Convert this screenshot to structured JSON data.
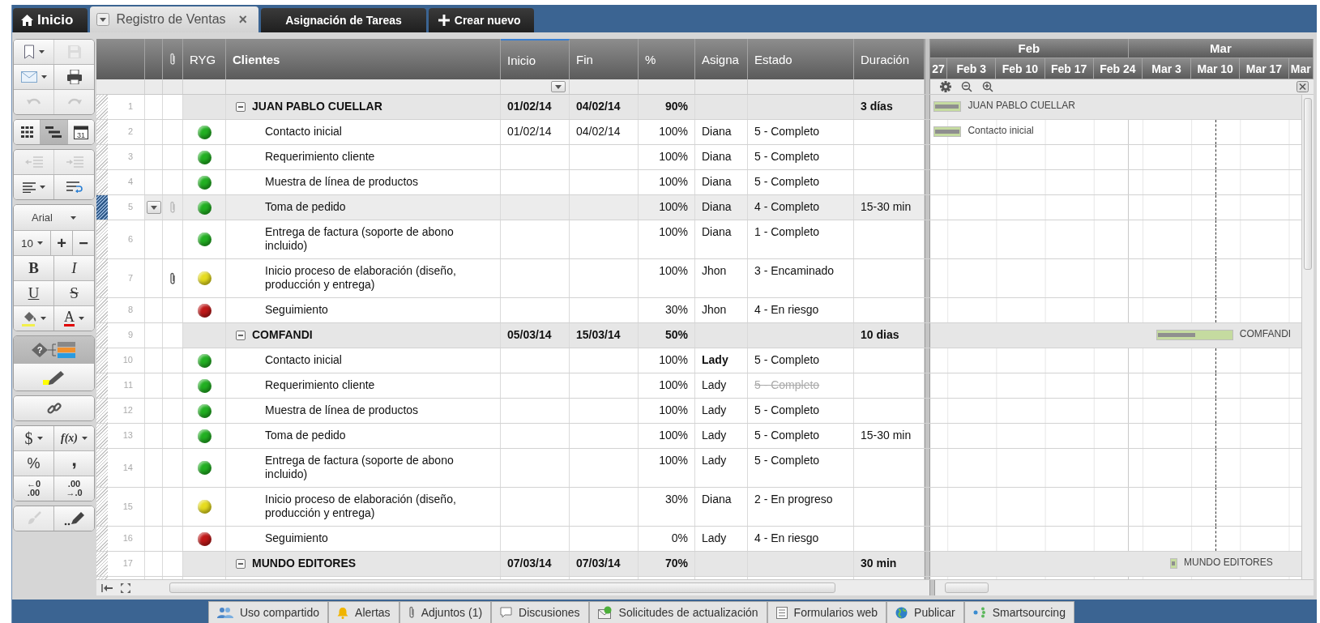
{
  "tabs": [
    {
      "label": "Inicio",
      "kind": "home",
      "selected": false
    },
    {
      "label": "Registro de Ventas",
      "kind": "sheet",
      "selected": true,
      "close": "×"
    },
    {
      "label": "Asignación de Tareas",
      "kind": "sheet",
      "selected": false
    },
    {
      "label": "Crear nuevo",
      "kind": "create",
      "selected": false
    }
  ],
  "toolbar": [
    [
      [
        {
          "kind": "bookmark",
          "dropdown": true,
          "disabled": false
        },
        {
          "kind": "save",
          "disabled": true
        }
      ],
      [
        {
          "kind": "email",
          "dropdown": true,
          "disabled": false
        },
        {
          "kind": "print",
          "disabled": false
        }
      ],
      [
        {
          "kind": "undo",
          "disabled": true
        },
        {
          "kind": "redo",
          "disabled": true
        }
      ]
    ],
    [
      [
        {
          "kind": "grid-view",
          "selected": false,
          "disabled": false
        },
        {
          "kind": "gantt-view",
          "selected": true,
          "disabled": false
        },
        {
          "kind": "calendar-view",
          "selected": false,
          "disabled": false,
          "text": "31"
        }
      ]
    ],
    [
      [
        {
          "kind": "outdent",
          "disabled": true
        },
        {
          "kind": "indent",
          "disabled": true
        }
      ],
      [
        {
          "kind": "align",
          "dropdown": true,
          "disabled": false
        },
        {
          "kind": "wrap-text",
          "disabled": false
        }
      ]
    ],
    [
      [
        {
          "kind": "font-family",
          "text": "Arial",
          "dropdown": true,
          "disabled": false
        }
      ],
      [
        {
          "kind": "font-size",
          "text": "10",
          "dropdown": true,
          "disabled": false
        },
        {
          "kind": "increase-size",
          "text": "+",
          "disabled": false
        },
        {
          "kind": "decrease-size",
          "text": "−",
          "disabled": false
        }
      ],
      [
        {
          "kind": "bold",
          "text": "B",
          "disabled": false
        },
        {
          "kind": "italic",
          "text": "I",
          "disabled": false
        }
      ],
      [
        {
          "kind": "underline",
          "text": "U",
          "disabled": false
        },
        {
          "kind": "strikethrough",
          "text": "S",
          "disabled": false
        }
      ],
      [
        {
          "kind": "fill-color",
          "dropdown": true,
          "disabled": false
        },
        {
          "kind": "text-color",
          "text": "A",
          "dropdown": true,
          "disabled": false
        }
      ]
    ],
    [
      [
        {
          "kind": "conditional-format",
          "text": "?",
          "on": true,
          "disabled": false
        }
      ],
      [
        {
          "kind": "highlight",
          "on": false,
          "disabled": false
        }
      ]
    ],
    [
      [
        {
          "kind": "link",
          "disabled": false
        }
      ]
    ],
    [
      [
        {
          "kind": "currency",
          "text": "$",
          "dropdown": true,
          "disabled": false
        },
        {
          "kind": "formula",
          "text": "f(x)",
          "dropdown": true,
          "disabled": false
        }
      ],
      [
        {
          "kind": "percent",
          "text": "%",
          "disabled": false
        },
        {
          "kind": "comma-style",
          "text": ",",
          "disabled": false
        }
      ],
      [
        {
          "kind": "decrease-decimals",
          "text": "←0",
          "text2": ".00",
          "disabled": false
        },
        {
          "kind": "increase-decimals",
          "text": ".00",
          "text2": "→.0",
          "disabled": false
        }
      ]
    ],
    [
      [
        {
          "kind": "clear-format",
          "disabled": true
        },
        {
          "kind": "format-painter",
          "disabled": false
        }
      ]
    ]
  ],
  "columns": [
    {
      "label": "RYG",
      "kind": "field",
      "sorted": false
    },
    {
      "label": "Clientes",
      "kind": "primary",
      "sorted": false
    },
    {
      "label": "Inicio",
      "kind": "field",
      "sorted": true
    },
    {
      "label": "Fin",
      "kind": "field",
      "sorted": false
    },
    {
      "label": "%",
      "kind": "field",
      "sorted": false
    },
    {
      "label": "Asigna",
      "kind": "field",
      "sorted": false
    },
    {
      "label": "Estado",
      "kind": "field",
      "sorted": false
    },
    {
      "label": "Duración",
      "kind": "field",
      "sorted": false
    }
  ],
  "gantt": {
    "months": [
      "Feb",
      "Mar"
    ],
    "weeks": [
      "27",
      "Feb 3",
      "Feb 10",
      "Feb 17",
      "Feb 24",
      "Mar 3",
      "Mar 10",
      "Mar 17",
      "Mar"
    ]
  },
  "rows": [
    {
      "num": "1",
      "kind": "group",
      "expanded": true,
      "selected": false,
      "attachment": false,
      "name": "JUAN PABLO CUELLAR",
      "inicio": "01/02/14",
      "fin": "04/02/14",
      "pct": "90%",
      "duracion": "3 días",
      "gantt": {
        "label": "JUAN PABLO CUELLAR",
        "level": 0.9
      }
    },
    {
      "num": "2",
      "kind": "task",
      "selected": false,
      "attachment": false,
      "color": "#22b022",
      "name": "Contacto inicial",
      "inicio": "01/02/14",
      "fin": "04/02/14",
      "pct": "100%",
      "asigna": "Diana",
      "asigna_bold": false,
      "estado": "5 - Completo",
      "estado_strike": false,
      "gantt": {
        "label": "Contacto inicial",
        "level": 1
      }
    },
    {
      "num": "3",
      "kind": "task",
      "selected": false,
      "attachment": false,
      "color": "#22b022",
      "name": "Requerimiento cliente",
      "pct": "100%",
      "asigna": "Diana",
      "asigna_bold": false,
      "estado": "5 - Completo",
      "estado_strike": false
    },
    {
      "num": "4",
      "kind": "task",
      "selected": false,
      "attachment": false,
      "color": "#22b022",
      "name": "Muestra de línea de productos",
      "pct": "100%",
      "asigna": "Diana",
      "asigna_bold": false,
      "estado": "5 - Completo",
      "estado_strike": false
    },
    {
      "num": "5",
      "kind": "task",
      "selected": true,
      "attachment": false,
      "color": "#22b022",
      "name": "Toma de pedido",
      "pct": "100%",
      "asigna": "Diana",
      "asigna_bold": false,
      "estado": "4 - Completo",
      "estado_strike": false,
      "duracion": "15-30 min"
    },
    {
      "num": "6",
      "kind": "task",
      "selected": false,
      "attachment": false,
      "color": "#22b022",
      "name": "Entrega de factura (soporte de abono incluido)",
      "pct": "100%",
      "asigna": "Diana",
      "asigna_bold": false,
      "estado": "1 - Completo",
      "estado_strike": false
    },
    {
      "num": "7",
      "kind": "task",
      "selected": false,
      "attachment": true,
      "color": "#e6dc1e",
      "name": "Inicio proceso de elaboración (diseño, producción y entrega)",
      "pct": "100%",
      "asigna": "Jhon",
      "asigna_bold": false,
      "estado": "3 - Encaminado",
      "estado_strike": false
    },
    {
      "num": "8",
      "kind": "task",
      "selected": false,
      "attachment": false,
      "color": "#c01818",
      "name": "Seguimiento",
      "pct": "30%",
      "asigna": "Jhon",
      "asigna_bold": false,
      "estado": "4 - En riesgo",
      "estado_strike": false
    },
    {
      "num": "9",
      "kind": "group",
      "expanded": true,
      "selected": false,
      "attachment": false,
      "name": "COMFANDI",
      "inicio": "05/03/14",
      "fin": "15/03/14",
      "pct": "50%",
      "duracion": "10 dias",
      "gantt": {
        "label": "COMFANDI",
        "level": 0.5
      }
    },
    {
      "num": "10",
      "kind": "task",
      "selected": false,
      "attachment": false,
      "color": "#22b022",
      "name": "Contacto inicial",
      "pct": "100%",
      "asigna": "Lady",
      "asigna_bold": true,
      "estado": "5 - Completo",
      "estado_strike": false
    },
    {
      "num": "11",
      "kind": "task",
      "selected": false,
      "attachment": false,
      "color": "#22b022",
      "name": "Requerimiento cliente",
      "pct": "100%",
      "asigna": "Lady",
      "asigna_bold": false,
      "estado": "5 - Completo",
      "estado_strike": true
    },
    {
      "num": "12",
      "kind": "task",
      "selected": false,
      "attachment": false,
      "color": "#22b022",
      "name": "Muestra de línea de productos",
      "pct": "100%",
      "asigna": "Lady",
      "asigna_bold": false,
      "estado": "5 - Completo",
      "estado_strike": false
    },
    {
      "num": "13",
      "kind": "task",
      "selected": false,
      "attachment": false,
      "color": "#22b022",
      "name": "Toma de pedido",
      "pct": "100%",
      "asigna": "Lady",
      "asigna_bold": false,
      "estado": "5 - Completo",
      "estado_strike": false,
      "duracion": "15-30 min"
    },
    {
      "num": "14",
      "kind": "task",
      "selected": false,
      "attachment": false,
      "color": "#22b022",
      "name": "Entrega de factura (soporte de abono incluido)",
      "pct": "100%",
      "asigna": "Lady",
      "asigna_bold": false,
      "estado": "5 - Completo",
      "estado_strike": false
    },
    {
      "num": "15",
      "kind": "task",
      "selected": false,
      "attachment": false,
      "color": "#e6dc1e",
      "name": "Inicio proceso de elaboración (diseño, producción y entrega)",
      "pct": "30%",
      "asigna": "Diana",
      "asigna_bold": false,
      "estado": "2 - En progreso",
      "estado_strike": false
    },
    {
      "num": "16",
      "kind": "task",
      "selected": false,
      "attachment": false,
      "color": "#c01818",
      "name": "Seguimiento",
      "pct": "0%",
      "asigna": "Lady",
      "asigna_bold": false,
      "estado": "4 - En riesgo",
      "estado_strike": false
    },
    {
      "num": "17",
      "kind": "group",
      "expanded": true,
      "selected": false,
      "attachment": false,
      "name": "MUNDO EDITORES",
      "inicio": "07/03/14",
      "fin": "07/03/14",
      "pct": "70%",
      "duracion": "30 min",
      "gantt": {
        "label": "MUNDO EDITORES"
      }
    }
  ],
  "bottom_tabs": [
    {
      "label": "Uso compartido",
      "kind": "sharing"
    },
    {
      "label": "Alertas",
      "kind": "alerts"
    },
    {
      "label": "Adjuntos (1)",
      "kind": "attachments"
    },
    {
      "label": "Discusiones",
      "kind": "discussions"
    },
    {
      "label": "Solicitudes de actualización",
      "kind": "update-requests"
    },
    {
      "label": "Formularios web",
      "kind": "web-forms"
    },
    {
      "label": "Publicar",
      "kind": "publish"
    },
    {
      "label": "Smartsourcing",
      "kind": "smartsourcing"
    }
  ]
}
